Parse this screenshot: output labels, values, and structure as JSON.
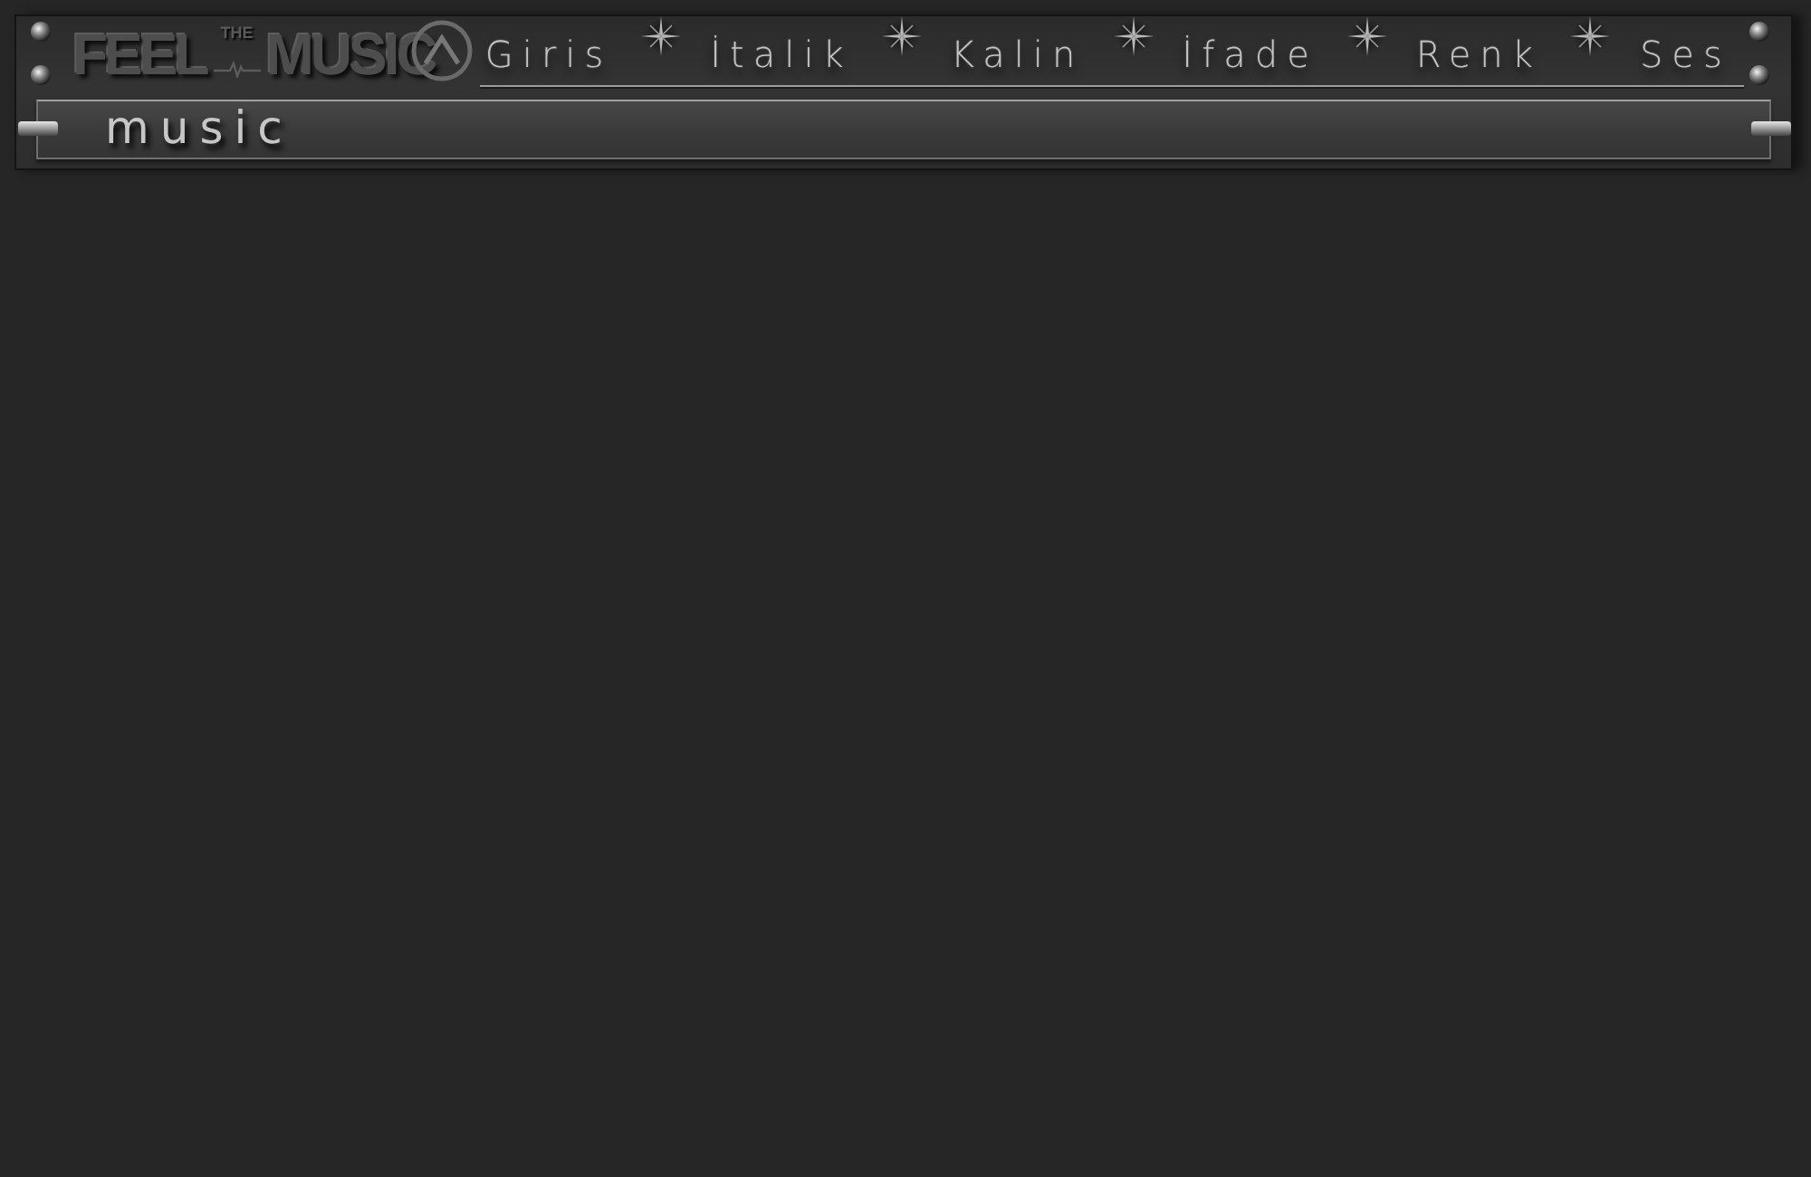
{
  "logo": {
    "word_1": "FEEL",
    "small_word": "THE",
    "word_2": "MUSIC"
  },
  "nav": [
    {
      "label": "Giris"
    },
    {
      "label": "İtalik"
    },
    {
      "label": "Kalin"
    },
    {
      "label": "İfade"
    },
    {
      "label": "Renk"
    },
    {
      "label": "Ses"
    }
  ],
  "title_bar": {
    "title": "music"
  }
}
